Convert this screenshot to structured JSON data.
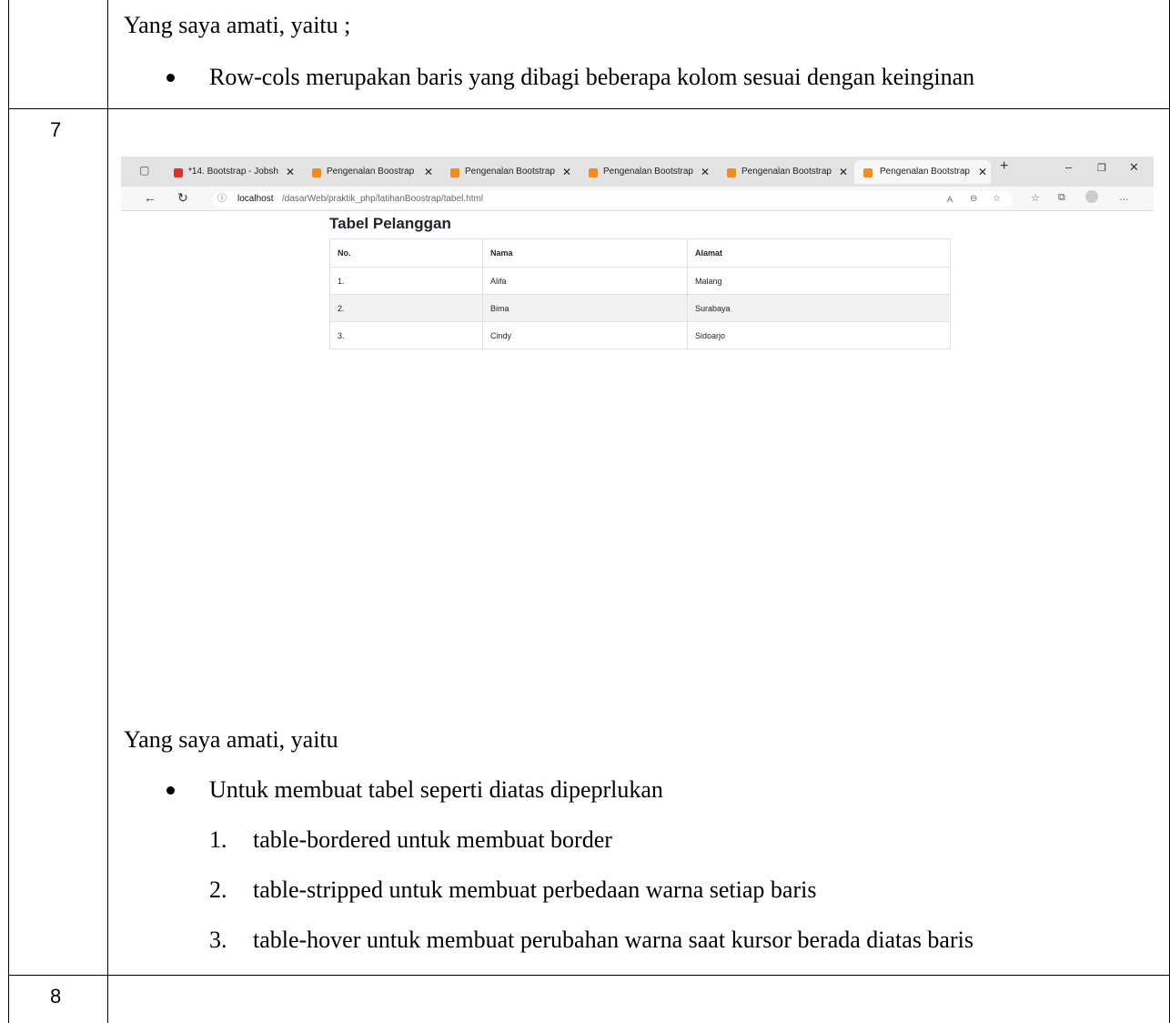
{
  "rows": [
    {
      "number": "",
      "intro": "Yang saya amati, yaitu ;",
      "bullet": "Row-cols merupakan baris yang dibagi beberapa kolom sesuai dengan keinginan"
    },
    {
      "number": "7",
      "intro": "Yang saya amati, yaitu",
      "bullet": "Untuk membuat tabel seperti diatas dipeprlukan",
      "numbered": [
        {
          "n": "1.",
          "text": "table-bordered untuk membuat border"
        },
        {
          "n": "2.",
          "text": "table-stripped untuk membuat perbedaan warna setiap baris"
        },
        {
          "n": "3.",
          "text": "table-hover untuk membuat perubahan warna saat kursor berada diatas baris"
        }
      ]
    },
    {
      "number": "8"
    }
  ],
  "browser": {
    "tabs": [
      {
        "label": "*14. Bootstrap - Jobsh",
        "icon": "pdf-icon"
      },
      {
        "label": "Pengenalan Boostrap",
        "icon": "xampp-icon"
      },
      {
        "label": "Pengenalan Bootstrap",
        "icon": "xampp-icon"
      },
      {
        "label": "Pengenalan Bootstrap",
        "icon": "xampp-icon"
      },
      {
        "label": "Pengenalan Bootstrap",
        "icon": "xampp-icon"
      },
      {
        "label": "Pengenalan Bootstrap",
        "icon": "xampp-icon",
        "active": true
      }
    ],
    "url_host": "localhost",
    "url_path": "/dasarWeb/praktik_php/latihanBoostrap/tabel.html",
    "accent": "#f28b22"
  },
  "page": {
    "heading": "Tabel Pelanggan",
    "columns": [
      "No.",
      "Nama",
      "Alamat"
    ],
    "customers": [
      [
        "1.",
        "Alifa",
        "Malang"
      ],
      [
        "2.",
        "Bima",
        "Surabaya"
      ],
      [
        "3.",
        "Cindy",
        "Sidoarjo"
      ]
    ]
  }
}
